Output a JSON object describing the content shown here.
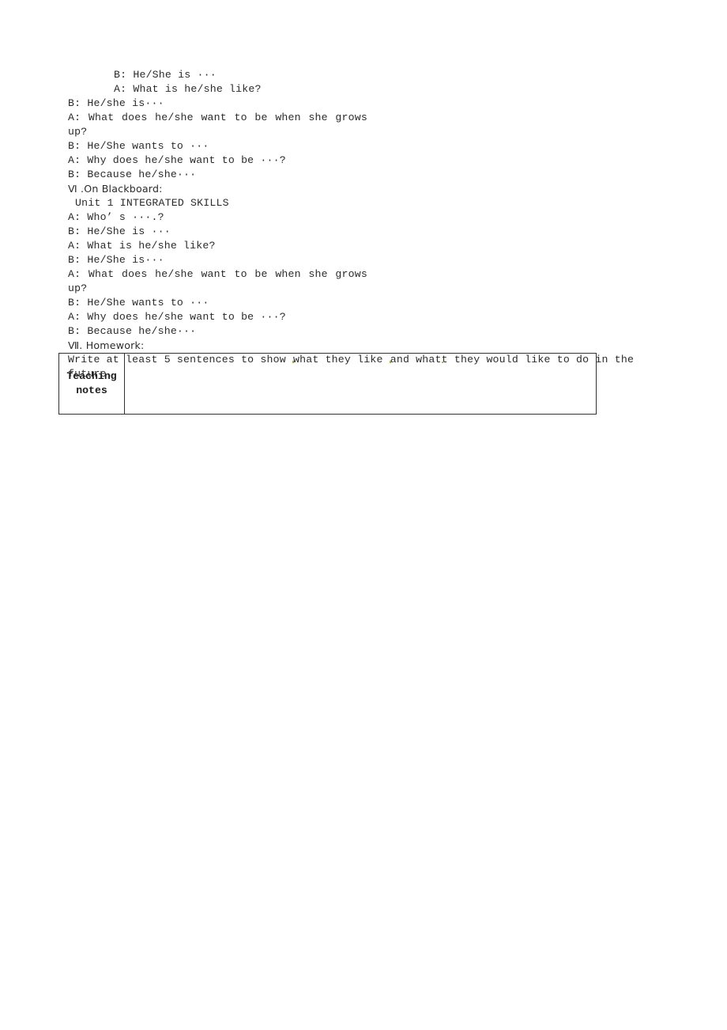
{
  "document": {
    "type": "lesson-plan-page",
    "body_lines": [
      {
        "id": "l1",
        "text": "B: He/She is ···",
        "style": "indent-big"
      },
      {
        "id": "l2",
        "text": "A: What is he/she like?",
        "style": "indent-big"
      },
      {
        "id": "l3",
        "text": "B: He/she is···",
        "style": "plain"
      },
      {
        "id": "l4",
        "text": "A: What does he/she want to be when she grows up?",
        "style": "justify-465"
      },
      {
        "id": "l5",
        "text": "B: He/She wants to ···",
        "style": "plain"
      },
      {
        "id": "l6",
        "text": "A: Why does he/she want to be ···?",
        "style": "plain-speck-to"
      },
      {
        "id": "l7",
        "text": "B: Because he/she···",
        "style": "plain"
      },
      {
        "id": "l8",
        "text": "Ⅵ .On Blackboard:",
        "style": "roman"
      },
      {
        "id": "l9",
        "text": "Unit 1 INTEGRATED SKILLS",
        "style": "indent-small"
      },
      {
        "id": "l10",
        "text": "A: Who’ s ···.?",
        "style": "plain"
      },
      {
        "id": "l11",
        "text": "B: He/She is ···",
        "style": "plain"
      },
      {
        "id": "l12",
        "text": "A: What is he/she like?",
        "style": "plain"
      },
      {
        "id": "l13",
        "text": "B: He/She is···",
        "style": "plain"
      },
      {
        "id": "l14",
        "text": "A: What does he/she want to be when she grows up?",
        "style": "justify-465"
      },
      {
        "id": "l15",
        "text": "B: He/She wants to ···",
        "style": "plain"
      },
      {
        "id": "l16",
        "text": "A: Why does he/she want to be ···?",
        "style": "plain"
      },
      {
        "id": "l17",
        "text": "B: Because he/she···",
        "style": "plain"
      },
      {
        "id": "l18",
        "text": "Ⅶ. Homework:",
        "style": "roman"
      }
    ],
    "homework": {
      "paragraph_part1": "Write at least 5 sentences to show ",
      "word_what1": "what",
      "paragraph_part2": " they like ",
      "word_and": "and",
      "paragraph_part3": " what",
      "word_t": "t",
      "paragraph_part4": " they would like to do in the",
      "paragraph_line2": "future.",
      "full_text": "Write at least 5 sentences to show what they like and what they would like to do in the future."
    },
    "table": {
      "label": "Teaching\nnotes",
      "label_line1": "Teaching",
      "label_line2": "notes",
      "body_text": ""
    }
  }
}
